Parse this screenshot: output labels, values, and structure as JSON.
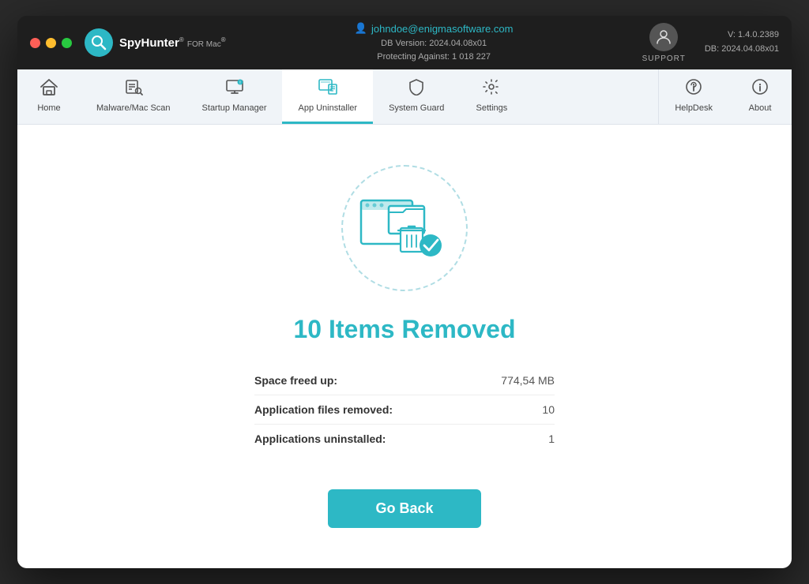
{
  "window": {
    "title": "SpyHunter for Mac"
  },
  "titlebar": {
    "logo_text": "SpyHunter",
    "logo_for": "FOR Mac",
    "user_email": "johndoe@enigmasoftware.com",
    "db_version": "DB Version: 2024.04.08x01",
    "protecting": "Protecting Against: 1 018 227",
    "support_label": "SUPPORT",
    "version": "V: 1.4.0.2389",
    "db_label": "DB:  2024.04.08x01"
  },
  "navbar": {
    "items": [
      {
        "id": "home",
        "label": "Home",
        "active": false
      },
      {
        "id": "malware-scan",
        "label": "Malware/Mac Scan",
        "active": false
      },
      {
        "id": "startup-manager",
        "label": "Startup Manager",
        "active": false
      },
      {
        "id": "app-uninstaller",
        "label": "App Uninstaller",
        "active": true
      },
      {
        "id": "system-guard",
        "label": "System Guard",
        "active": false
      },
      {
        "id": "settings",
        "label": "Settings",
        "active": false
      }
    ],
    "right_items": [
      {
        "id": "helpdesk",
        "label": "HelpDesk"
      },
      {
        "id": "about",
        "label": "About"
      }
    ]
  },
  "main": {
    "result_title": "10 Items Removed",
    "stats": [
      {
        "label": "Space freed up:",
        "value": "774,54 MB"
      },
      {
        "label": "Application files removed:",
        "value": "10"
      },
      {
        "label": "Applications uninstalled:",
        "value": "1"
      }
    ],
    "go_back_label": "Go Back"
  }
}
